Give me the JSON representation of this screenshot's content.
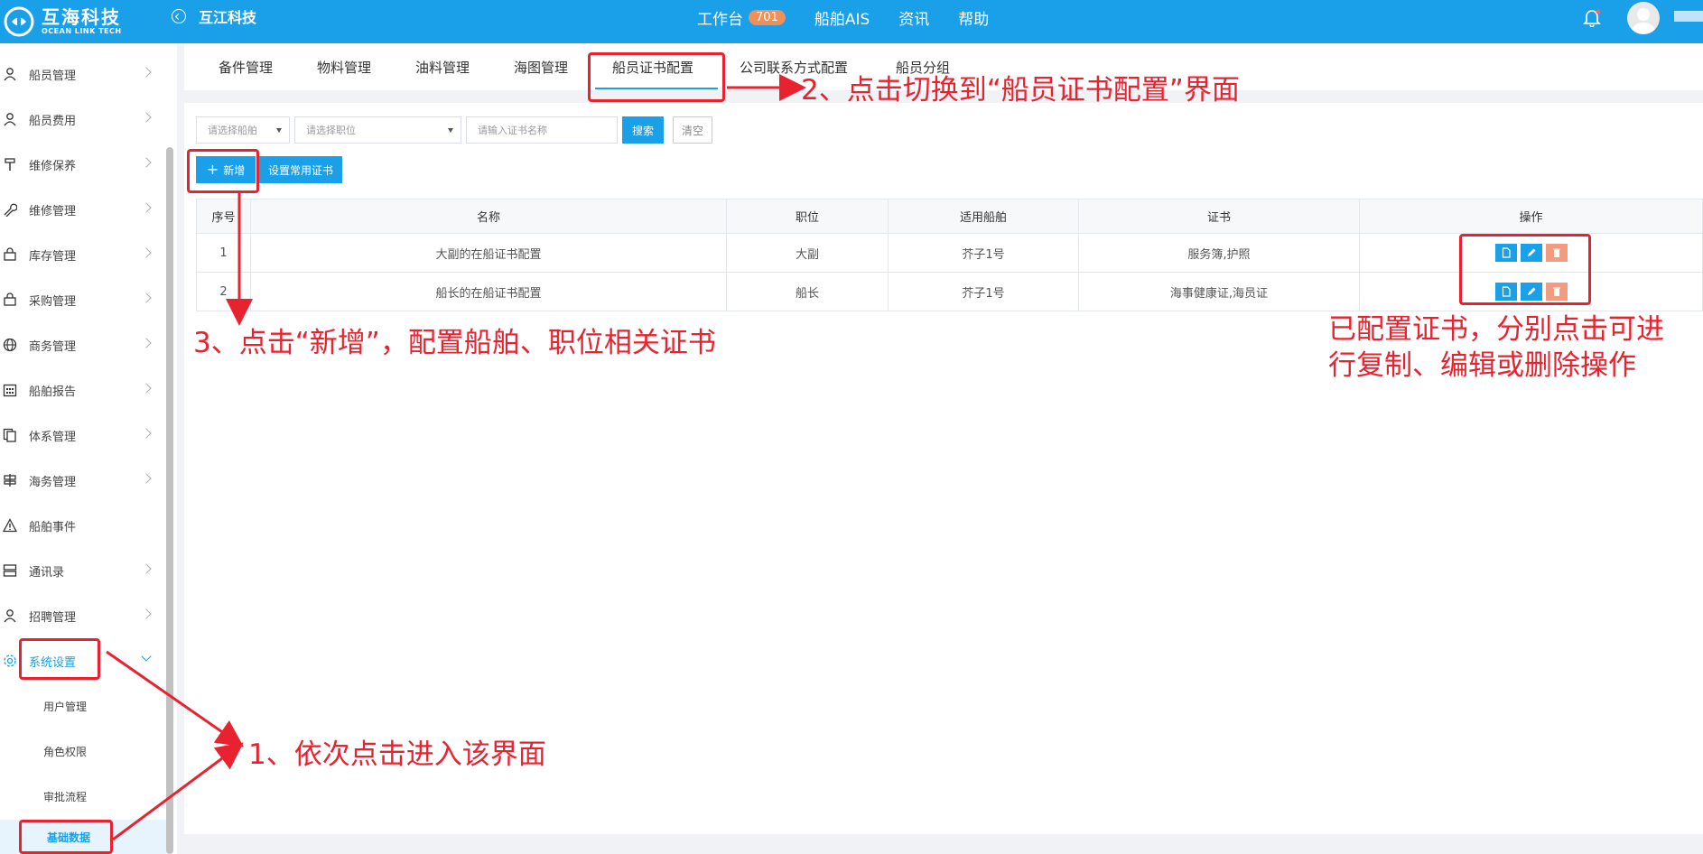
{
  "header": {
    "logo_title": "互海科技",
    "logo_subtitle": "OCEAN LINK TECH",
    "company": "互江科技",
    "nav": [
      {
        "label": "工作台",
        "badge": "701"
      },
      {
        "label": "船舶AIS"
      },
      {
        "label": "资讯"
      },
      {
        "label": "帮助"
      }
    ]
  },
  "sidebar": {
    "items": [
      {
        "label": "船员管理",
        "icon": "user-icon"
      },
      {
        "label": "船员费用",
        "icon": "user-icon"
      },
      {
        "label": "维修保养",
        "icon": "hammer-icon"
      },
      {
        "label": "维修管理",
        "icon": "wrench-icon"
      },
      {
        "label": "库存管理",
        "icon": "bag-icon"
      },
      {
        "label": "采购管理",
        "icon": "bag-icon"
      },
      {
        "label": "商务管理",
        "icon": "globe-icon"
      },
      {
        "label": "船舶报告",
        "icon": "calendar-icon"
      },
      {
        "label": "体系管理",
        "icon": "document-icon"
      },
      {
        "label": "海务管理",
        "icon": "signpost-icon"
      },
      {
        "label": "船舶事件",
        "icon": "warning-icon"
      },
      {
        "label": "通讯录",
        "icon": "server-icon"
      },
      {
        "label": "招聘管理",
        "icon": "user-icon"
      },
      {
        "label": "系统设置",
        "icon": "gear-icon"
      }
    ],
    "sub_items": [
      "用户管理",
      "角色权限",
      "审批流程",
      "基础数据"
    ]
  },
  "tabs": [
    "备件管理",
    "物料管理",
    "油料管理",
    "海图管理",
    "船员证书配置",
    "公司联系方式配置",
    "船员分组"
  ],
  "filters": {
    "ship_placeholder": "请选择船舶",
    "position_placeholder": "请选择职位",
    "cert_placeholder": "请输入证书名称",
    "search_label": "搜索",
    "clear_label": "清空"
  },
  "actions": {
    "add_label": "新增",
    "common_cert_label": "设置常用证书"
  },
  "table": {
    "headers": [
      "序号",
      "名称",
      "职位",
      "适用船舶",
      "证书",
      "操作"
    ],
    "rows": [
      {
        "index": "1",
        "name": "大副的在船证书配置",
        "position": "大副",
        "ship": "芥子1号",
        "cert": "服务簿,护照"
      },
      {
        "index": "2",
        "name": "船长的在船证书配置",
        "position": "船长",
        "ship": "芥子1号",
        "cert": "海事健康证,海员证"
      }
    ]
  },
  "annotations": {
    "step1": "1、依次点击进入该界面",
    "step2": "2、点击切换到“船员证书配置”界面",
    "step3": "3、点击“新增”，配置船舶、职位相关证书",
    "note_line1": "已配置证书，分别点击可进",
    "note_line2": "行复制、编辑或删除操作"
  },
  "colors": {
    "primary": "#1aa0e8",
    "annotation": "#e8232f",
    "badge": "#ef8f5a",
    "delete": "#f29b7f"
  }
}
